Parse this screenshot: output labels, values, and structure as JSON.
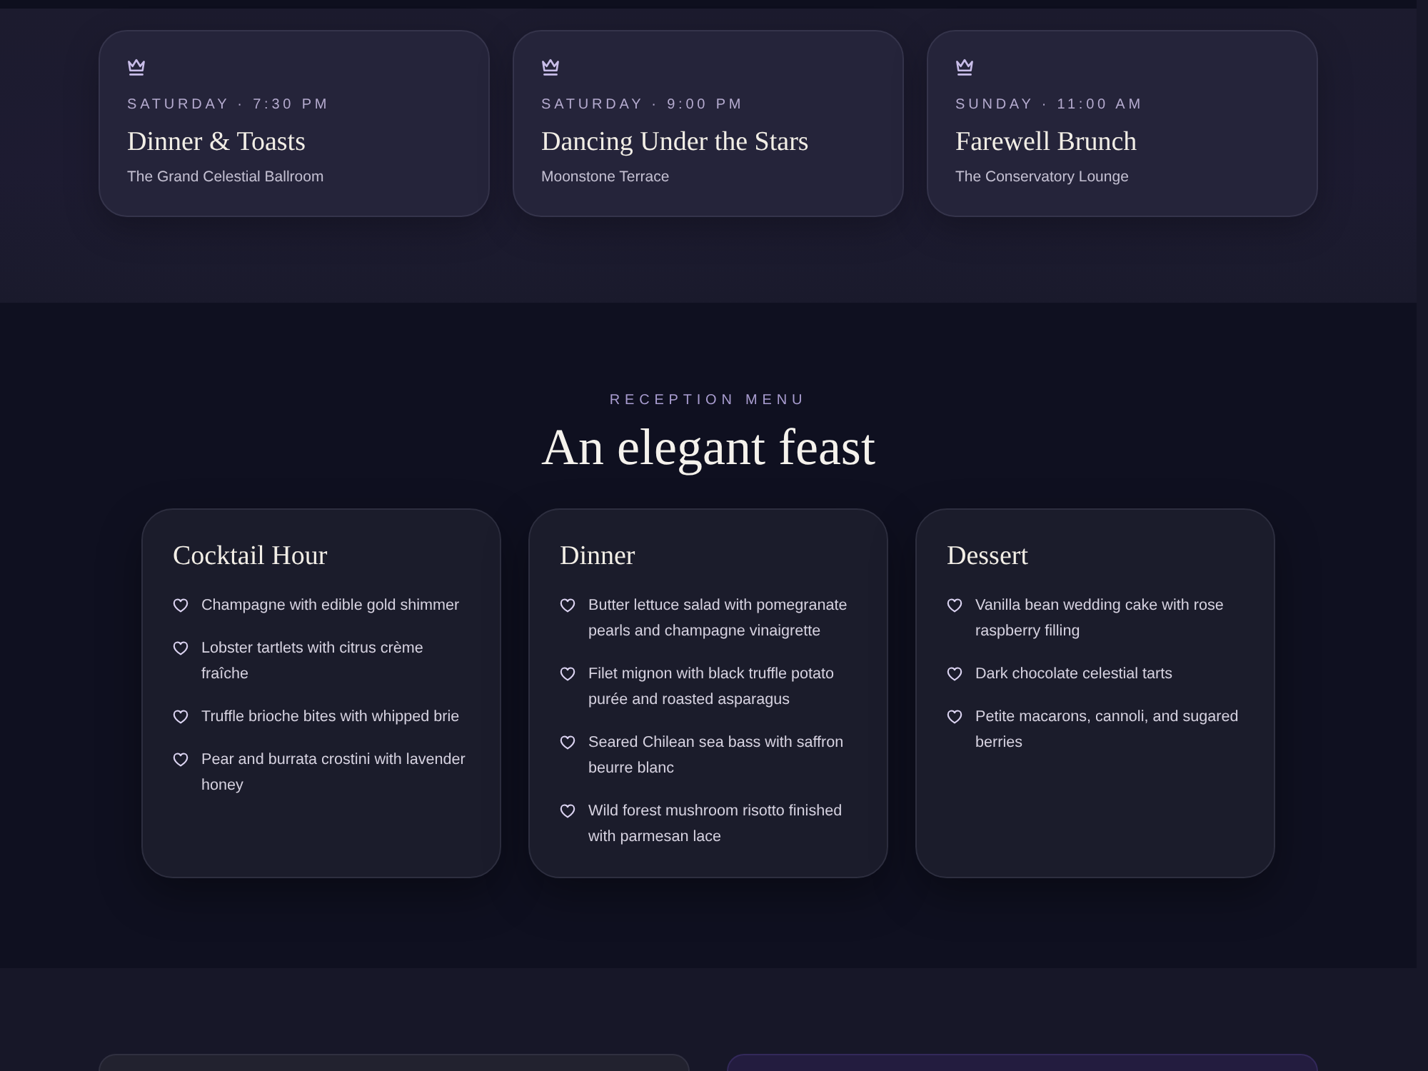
{
  "events": [
    {
      "when": "SATURDAY · 7:30 PM",
      "title": "Dinner & Toasts",
      "venue": "The Grand Celestial Ballroom"
    },
    {
      "when": "SATURDAY · 9:00 PM",
      "title": "Dancing Under the Stars",
      "venue": "Moonstone Terrace"
    },
    {
      "when": "SUNDAY · 11:00 AM",
      "title": "Farewell Brunch",
      "venue": "The Conservatory Lounge"
    }
  ],
  "menu": {
    "eyebrow": "RECEPTION MENU",
    "heading": "An elegant feast",
    "courses": [
      {
        "title": "Cocktail Hour",
        "items": [
          "Champagne with edible gold shimmer",
          "Lobster tartlets with citrus crème fraîche",
          "Truffle brioche bites with whipped brie",
          "Pear and burrata crostini with lavender honey"
        ]
      },
      {
        "title": "Dinner",
        "items": [
          "Butter lettuce salad with pomegranate pearls and champagne vinaigrette",
          "Filet mignon with black truffle potato purée and roasted asparagus",
          "Seared Chilean sea bass with saffron beurre blanc",
          "Wild forest mushroom risotto finished with parmesan lace"
        ]
      },
      {
        "title": "Dessert",
        "items": [
          "Vanilla bean wedding cake with rose raspberry filling",
          "Dark chocolate celestial tarts",
          "Petite macarons, cannoli, and sugared berries"
        ]
      }
    ]
  },
  "next_section": {
    "cards": [
      {
        "kind": "plain"
      },
      {
        "kind": "accent"
      }
    ]
  }
}
